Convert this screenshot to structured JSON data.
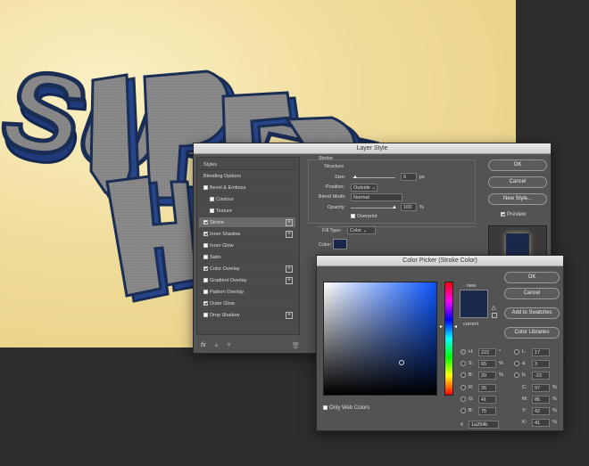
{
  "canvas": {
    "artwork_text": [
      "SUPER",
      "H"
    ]
  },
  "layer_style": {
    "title": "Layer Style",
    "styles_header": "Styles",
    "items": [
      {
        "label": "Blending Options",
        "checkbox": false,
        "plus": false
      },
      {
        "label": "Bevel & Emboss",
        "checkbox": true,
        "checked": false,
        "plus": false
      },
      {
        "label": "Contour",
        "checkbox": true,
        "checked": false,
        "plus": false,
        "indent": true
      },
      {
        "label": "Texture",
        "checkbox": true,
        "checked": false,
        "plus": false,
        "indent": true
      },
      {
        "label": "Stroke",
        "checkbox": true,
        "checked": true,
        "plus": true,
        "selected": true
      },
      {
        "label": "Inner Shadow",
        "checkbox": true,
        "checked": true,
        "plus": true
      },
      {
        "label": "Inner Glow",
        "checkbox": true,
        "checked": false,
        "plus": false
      },
      {
        "label": "Satin",
        "checkbox": true,
        "checked": false,
        "plus": false
      },
      {
        "label": "Color Overlay",
        "checkbox": true,
        "checked": true,
        "plus": true
      },
      {
        "label": "Gradient Overlay",
        "checkbox": true,
        "checked": false,
        "plus": true
      },
      {
        "label": "Pattern Overlay",
        "checkbox": true,
        "checked": false,
        "plus": false
      },
      {
        "label": "Outer Glow",
        "checkbox": true,
        "checked": true,
        "plus": false
      },
      {
        "label": "Drop Shadow",
        "checkbox": true,
        "checked": false,
        "plus": true
      }
    ],
    "stroke_title": "Stroke",
    "structure_title": "Structure",
    "size_label": "Size:",
    "size_value": "6",
    "size_unit": "px",
    "position_label": "Position:",
    "position_value": "Outside",
    "blend_label": "Blend Mode:",
    "blend_value": "Normal",
    "opacity_label": "Opacity:",
    "opacity_value": "100",
    "opacity_unit": "%",
    "overprint_label": "Overprint",
    "fill_type_label": "Fill Type:",
    "fill_type_value": "Color",
    "color_label": "Color:",
    "ok": "OK",
    "cancel": "Cancel",
    "new_style": "New Style...",
    "preview": "Preview",
    "fx": "fx"
  },
  "color_picker": {
    "title": "Color Picker (Stroke Color)",
    "ok": "OK",
    "cancel": "Cancel",
    "add_swatches": "Add to Swatches",
    "color_libraries": "Color Libraries",
    "new_label": "new",
    "current_label": "current",
    "only_web": "Only Web Colors",
    "hsb": [
      {
        "k": "H:",
        "v": "222",
        "u": "°"
      },
      {
        "k": "S:",
        "v": "65",
        "u": "%"
      },
      {
        "k": "B:",
        "v": "29",
        "u": "%"
      }
    ],
    "rgb": [
      {
        "k": "R:",
        "v": "26"
      },
      {
        "k": "G:",
        "v": "41"
      },
      {
        "k": "B:",
        "v": "75"
      }
    ],
    "lab": [
      {
        "k": "L:",
        "v": "17"
      },
      {
        "k": "a:",
        "v": "3"
      },
      {
        "k": "b:",
        "v": "-23"
      }
    ],
    "cmyk": [
      {
        "k": "C:",
        "v": "97",
        "u": "%"
      },
      {
        "k": "M:",
        "v": "86",
        "u": "%"
      },
      {
        "k": "Y:",
        "v": "42",
        "u": "%"
      },
      {
        "k": "K:",
        "v": "41",
        "u": "%"
      }
    ],
    "hex_label": "#",
    "hex_value": "1a294b",
    "selected_color": "#1a294b"
  }
}
